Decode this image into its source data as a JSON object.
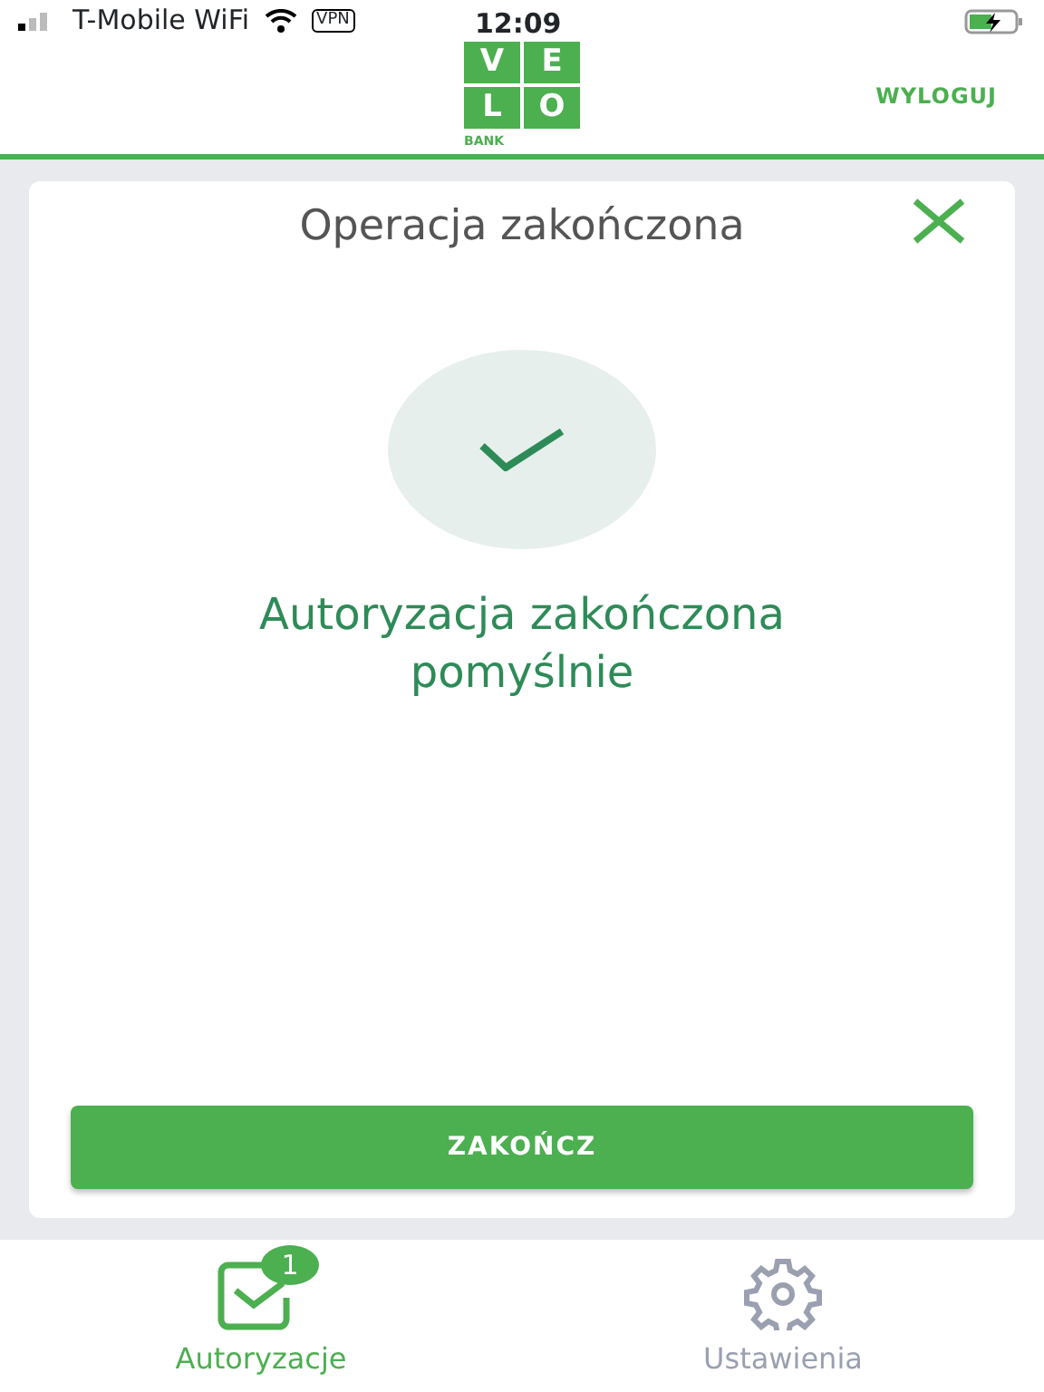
{
  "status_bar": {
    "carrier": "T-Mobile WiFi",
    "vpn": "VPN",
    "time": "12:09"
  },
  "header": {
    "logo_letters": [
      "V",
      "E",
      "L",
      "O"
    ],
    "logo_caption": "BANK",
    "logout": "WYLOGUJ"
  },
  "dialog": {
    "title": "Operacja zakończona",
    "message": "Autoryzacja zakończona pomyślnie",
    "button": "ZAKOŃCZ"
  },
  "tabs": [
    {
      "label": "Autoryzacje",
      "selected": true,
      "kind": "auth",
      "badge": "1"
    },
    {
      "label": "Ustawienia",
      "selected": false,
      "kind": "settings"
    }
  ]
}
